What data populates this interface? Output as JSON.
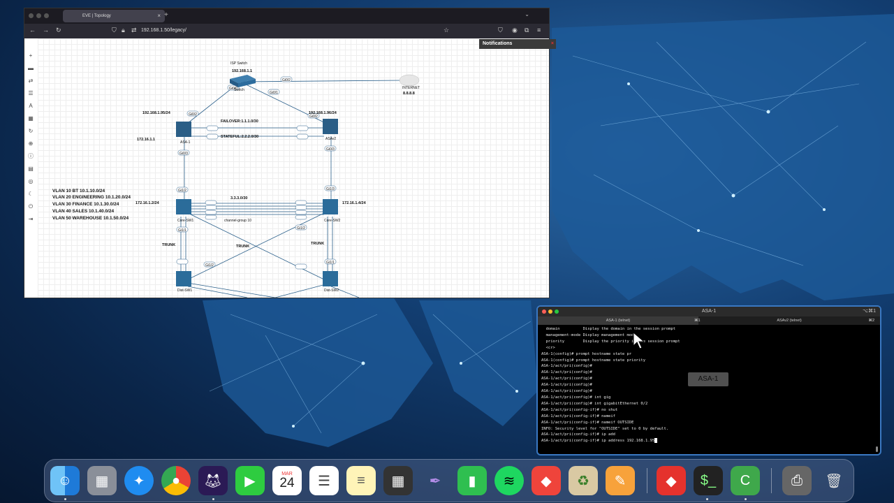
{
  "browser": {
    "tab_title": "EVE | Topology",
    "tab_close": "×",
    "tab_new": "+",
    "url": "192.168.1.50/legacy/",
    "notifications_label": "Notifications"
  },
  "topology": {
    "isp_switch_label": "ISP Switch",
    "isp_switch_ip": "192.168.1.1",
    "switch_name": "Switch",
    "internet_label": "INTERNET",
    "internet_ip": "8.8.8.8",
    "asa1_ip": "192.168.1.95/24",
    "asa2_ip": "192.168.1.96/24",
    "asa1_name": "ASA-1",
    "asa2_name": "ASAv2",
    "asa1_inside_ip": "172.16.1.1",
    "failover_label": "FAILOVER:1.1.1.0/30",
    "stateful_label": "STATEFUL:2.2.2.0/30",
    "core1_name": "Core-SW1",
    "core2_name": "Core-SW2",
    "core1_ip": "172.16.1.2/24",
    "core2_ip": "172.16.1.4/24",
    "portchannel_net": "3.3.3.0/30",
    "channel_group": "channel-group 10",
    "trunk_left": "TRUNK",
    "trunk_mid": "TRUNK",
    "trunk_right": "TRUNK",
    "dist1_name": "Dist-SW1",
    "dist2_name": "Dist-SW2",
    "ports": {
      "sw_gi00": "Gi0/0",
      "sw_gi01": "Gi0/1",
      "sw_gi02": "Gi0/2",
      "asa1_gi02": "Gi0/2",
      "asa2_gi02": "Gi0/2",
      "asa1_gi03": "Gi0/3",
      "asa2_gi03": "Gi0/3",
      "core1_gi12": "Gi1/2",
      "core2_gi13": "Gi1/3",
      "core1_gi11": "Gi1/1",
      "core2_gi11": "Gi1/1",
      "core1_gi22": "Gi1/2",
      "core2_gi12": "Gi1/2"
    },
    "vlans": [
      "VLAN 10 BT 10.1.10.0/24",
      "VLAN 20 ENGINEERING 10.1.20.0/24",
      "VLAN 30 FINANCE 10.1.30.0/24",
      "VLAN 40 SALES 10.1.40.0/24",
      "VLAN 50 WAREHOUSE 10.1.50.0/24"
    ]
  },
  "terminal": {
    "window_title": "ASA-1",
    "window_shortcut": "⌥⌘1",
    "tab1_label": "ASA-1 (telnet)",
    "tab1_key": "⌘1",
    "tab2_label": "ASAv2 (telnet)",
    "tab2_key": "⌘2",
    "badge": "ASA-1",
    "lines": [
      "  domain          Display the domain in the session prompt",
      "  management-mode Display management mode",
      "  priority        Display the priority in the session prompt",
      "  <cr>",
      "ASA-1(config)# prompt hostname state pr",
      "ASA-1(config)# prompt hostname state priority",
      "ASA-1/act/pri(config)#",
      "ASA-1/act/pri(config)#",
      "ASA-1/act/pri(config)#",
      "ASA-1/act/pri(config)#",
      "ASA-1/act/pri(config)#",
      "ASA-1/act/pri(config)# int gig",
      "ASA-1/act/pri(config)# int gigabitEthernet 0/2",
      "ASA-1/act/pri(config-if)# no shut",
      "ASA-1/act/pri(config-if)# nameif",
      "ASA-1/act/pri(config-if)# nameif OUTSIDE",
      "INFO: Security level for \"OUTSIDE\" set to 0 by default.",
      "ASA-1/act/pri(config-if)# ip add",
      "ASA-1/act/pri(config-if)# ip address 192.168.1.95"
    ]
  },
  "dock": {
    "calendar_month": "MAR",
    "calendar_day": "24",
    "apps": [
      "finder-icon",
      "launchpad-icon",
      "safari-icon",
      "chrome-icon",
      "firefox-icon",
      "facetime-icon",
      "calendar-icon",
      "reminders-icon",
      "notes-icon",
      "calculator-icon",
      "feather-icon",
      "numbers-icon",
      "spotify-icon",
      "anydesk-icon",
      "recycle-icon",
      "pages-icon",
      "remote-icon",
      "terminal-icon",
      "camtasia-icon",
      "printer-icon",
      "trash-icon"
    ]
  }
}
